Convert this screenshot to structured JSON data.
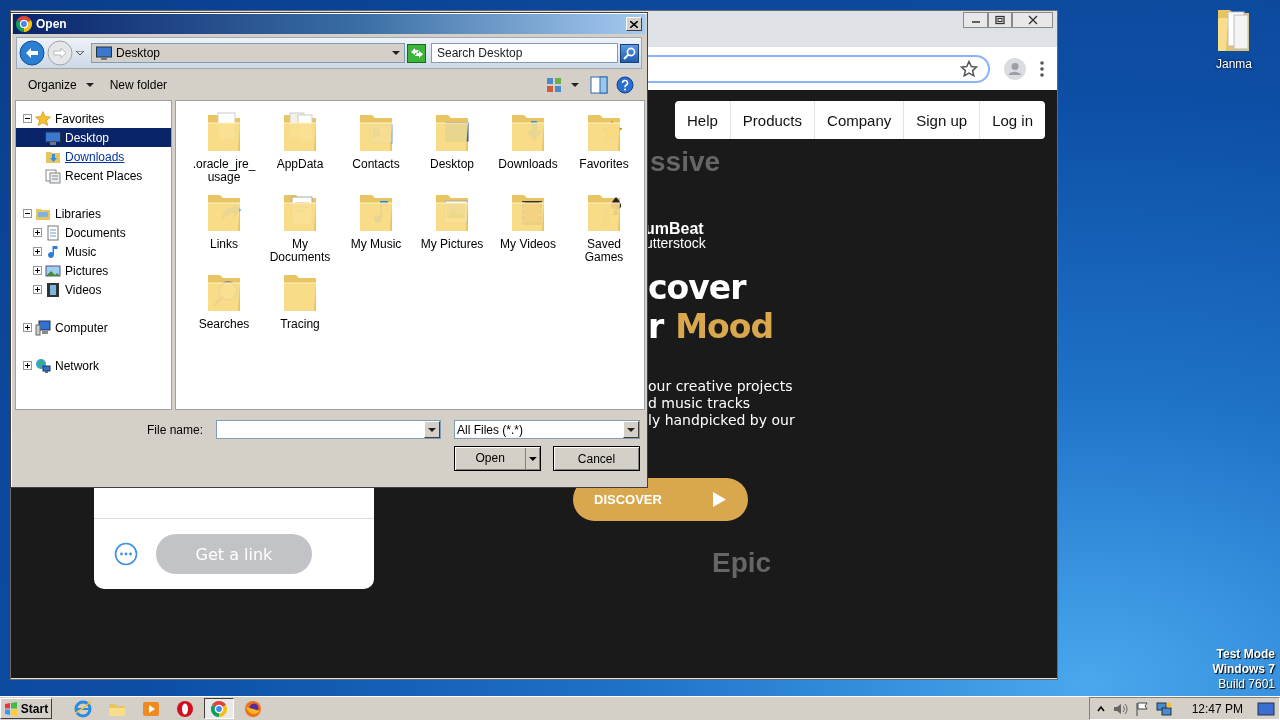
{
  "dialog": {
    "title": "Open",
    "location": "Desktop",
    "search": {
      "placeholder": "Search Desktop"
    },
    "toolbar": [
      "Organize",
      "New folder"
    ],
    "tree": [
      {
        "label": "Favorites",
        "expanded": true,
        "selected": false,
        "hovered": false,
        "children": [
          {
            "label": "Desktop",
            "selected": true,
            "hovered": false
          },
          {
            "label": "Downloads",
            "selected": false,
            "hovered": true
          },
          {
            "label": "Recent Places",
            "selected": false,
            "hovered": false
          }
        ]
      },
      {
        "label": "Libraries",
        "expanded": true,
        "selected": false,
        "hovered": false,
        "children": [
          {
            "label": "Documents",
            "expanded": false,
            "selected": false,
            "hovered": false
          },
          {
            "label": "Music",
            "expanded": false,
            "selected": false,
            "hovered": false
          },
          {
            "label": "Pictures",
            "expanded": false,
            "selected": false,
            "hovered": false
          },
          {
            "label": "Videos",
            "expanded": false,
            "selected": false,
            "hovered": false
          }
        ]
      },
      {
        "label": "Computer",
        "expanded": false,
        "selected": false,
        "hovered": false
      },
      {
        "label": "Network",
        "expanded": false,
        "selected": false,
        "hovered": false
      }
    ],
    "files": [
      ".oracle_jre_usage",
      "AppData",
      "Contacts",
      "Desktop",
      "Downloads",
      "Favorites",
      "Links",
      "My Documents",
      "My Music",
      "My Pictures",
      "My Videos",
      "Saved Games",
      "Searches",
      "Tracing"
    ],
    "file_name_label": "File name:",
    "filter": "All Files (*.*)",
    "buttons": [
      {
        "label": "Open",
        "kind": "split"
      },
      {
        "label": "Cancel",
        "kind": "plain"
      }
    ]
  },
  "browser": {
    "nav": [
      "Help",
      "Products",
      "Company",
      "Sign up",
      "Log in"
    ],
    "hero": {
      "blurred_top": "ssive",
      "logo": [
        "umBeat",
        "utterstock"
      ],
      "heading": "cover",
      "heading_2": {
        "text": "r",
        "accent": "Mood"
      },
      "lines": [
        "our creative projects",
        "d music tracks",
        "ly handpicked by our"
      ],
      "button": "DISCOVER",
      "blurred_bottom": "Epic"
    },
    "card": {
      "button": "Get a link"
    }
  },
  "desktop": {
    "icons": [
      {
        "label": "Janma"
      }
    ],
    "notice": [
      "Test Mode",
      "Windows 7",
      "Build 7601"
    ]
  },
  "taskbar": {
    "start": "Start",
    "apps": [
      {
        "selected": false
      },
      {
        "selected": false
      },
      {
        "selected": false
      },
      {
        "selected": false
      },
      {
        "selected": true
      },
      {
        "selected": false
      }
    ],
    "clock": "12:47 PM"
  }
}
